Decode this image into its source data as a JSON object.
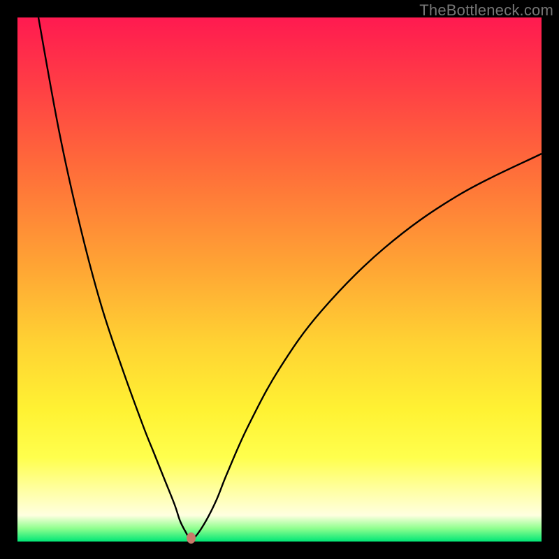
{
  "watermark": "TheBottleneck.com",
  "chart_data": {
    "type": "line",
    "title": "",
    "xlabel": "",
    "ylabel": "",
    "xlim": [
      0,
      100
    ],
    "ylim": [
      0,
      100
    ],
    "grid": false,
    "legend": false,
    "background": {
      "gradient": "vertical",
      "stops": [
        {
          "pos": 0.0,
          "color": "#ff1a50"
        },
        {
          "pos": 0.12,
          "color": "#ff3b46"
        },
        {
          "pos": 0.28,
          "color": "#ff6a3a"
        },
        {
          "pos": 0.48,
          "color": "#ffa634"
        },
        {
          "pos": 0.62,
          "color": "#ffd233"
        },
        {
          "pos": 0.75,
          "color": "#fff233"
        },
        {
          "pos": 0.84,
          "color": "#ffff4d"
        },
        {
          "pos": 0.9,
          "color": "#ffffa0"
        },
        {
          "pos": 0.95,
          "color": "#ffffe0"
        },
        {
          "pos": 0.975,
          "color": "#8fff8f"
        },
        {
          "pos": 1.0,
          "color": "#00e676"
        }
      ]
    },
    "series": [
      {
        "name": "bottleneck-curve",
        "color": "#000000",
        "x": [
          4,
          8,
          12,
          16,
          20,
          24,
          26,
          28,
          30,
          31,
          32,
          33,
          34,
          36,
          38,
          40,
          44,
          50,
          58,
          70,
          84,
          100
        ],
        "y": [
          100,
          78,
          60,
          45,
          33,
          22,
          17,
          12,
          7,
          4,
          2,
          0.5,
          1,
          4,
          8,
          13,
          22,
          33,
          44,
          56,
          66,
          74
        ]
      }
    ],
    "markers": [
      {
        "name": "optimum-point",
        "x": 33,
        "y": 0.5,
        "color": "#c77a6a"
      }
    ]
  }
}
